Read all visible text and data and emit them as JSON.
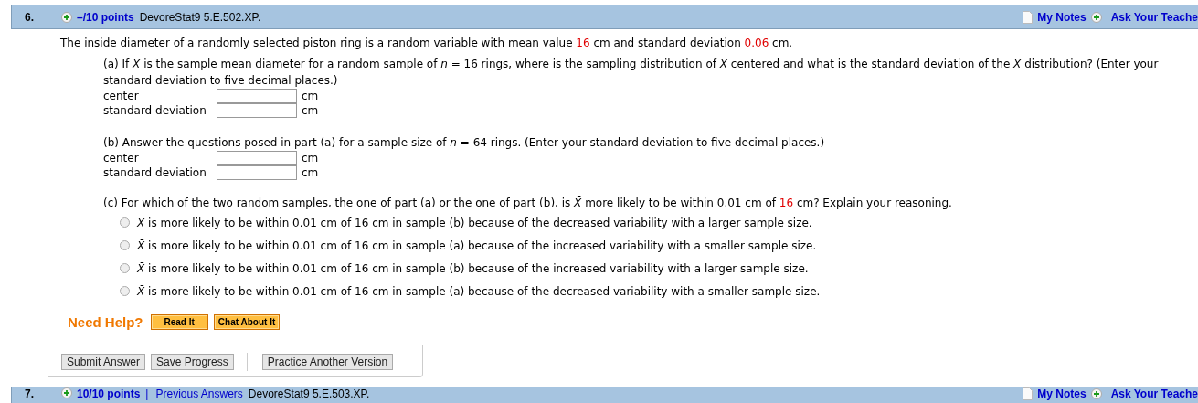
{
  "question": {
    "number": "6.",
    "points": "–/10 points",
    "source": "DevoreStat9 5.E.502.XP.",
    "my_notes": "My Notes",
    "ask_teacher": "Ask Your Teache"
  },
  "intro": [
    {
      "text": "The inside diameter of a randomly selected piston ring is a random variable with mean value ",
      "highlight": false
    },
    {
      "text": "16",
      "highlight": true
    },
    {
      "text": " cm and standard deviation ",
      "highlight": false
    },
    {
      "text": "0.06",
      "highlight": true
    },
    {
      "text": " cm.",
      "highlight": false
    }
  ],
  "parts": [
    {
      "prompt": [
        {
          "text": "(a) If *X̄* is the sample mean diameter for a random sample of *n* = 16 rings, where is the sampling distribution of *X̄* centered and what is the standard deviation of the *X̄* distribution? (Enter your standard deviation to five decimal places.)",
          "highlight": false
        }
      ],
      "fields": [
        {
          "label": "center",
          "unit": "cm"
        },
        {
          "label": "standard deviation",
          "unit": "cm"
        }
      ]
    },
    {
      "prompt": [
        {
          "text": "(b) Answer the questions posed in part (a) for a sample size of *n* = 64 rings. (Enter your standard deviation to five decimal places.)",
          "highlight": false
        }
      ],
      "fields": [
        {
          "label": "center",
          "unit": "cm"
        },
        {
          "label": "standard deviation",
          "unit": "cm"
        }
      ]
    },
    {
      "prompt": [
        {
          "text": "(c) For which of the two random samples, the one of part (a) or the one of part (b), is *X̄* more likely to be within 0.01 cm of ",
          "highlight": false
        },
        {
          "text": "16",
          "highlight": true
        },
        {
          "text": " cm? Explain your reasoning.",
          "highlight": false
        }
      ],
      "options": [
        {
          "text": "*X̄* is more likely to be within 0.01 cm of 16 cm in sample (b) because of the decreased variability with a larger sample size.",
          "selected": false
        },
        {
          "text": "*X̄* is more likely to be within 0.01 cm of 16 cm in sample (a) because of the increased variability with a smaller sample size.",
          "selected": false
        },
        {
          "text": "*X̄* is more likely to be within 0.01 cm of 16 cm in sample (b) because of the increased variability with a larger sample size.",
          "selected": false
        },
        {
          "text": "*X̄* is more likely to be within 0.01 cm of 16 cm in sample (a) because of the decreased variability with a smaller sample size.",
          "selected": false
        }
      ]
    }
  ],
  "help": {
    "label": "Need Help?",
    "buttons": [
      "Read It",
      "Chat About It"
    ]
  },
  "actions": [
    "Submit Answer",
    "Save Progress"
  ],
  "other_actions": [
    "Practice Another Version"
  ],
  "next_question": {
    "number": "7.",
    "points": "10/10 points",
    "separator": "|",
    "previous": "Previous Answers",
    "source": "DevoreStat9 5.E.503.XP.",
    "my_notes": "My Notes",
    "ask_teacher": "Ask Your Teache"
  }
}
